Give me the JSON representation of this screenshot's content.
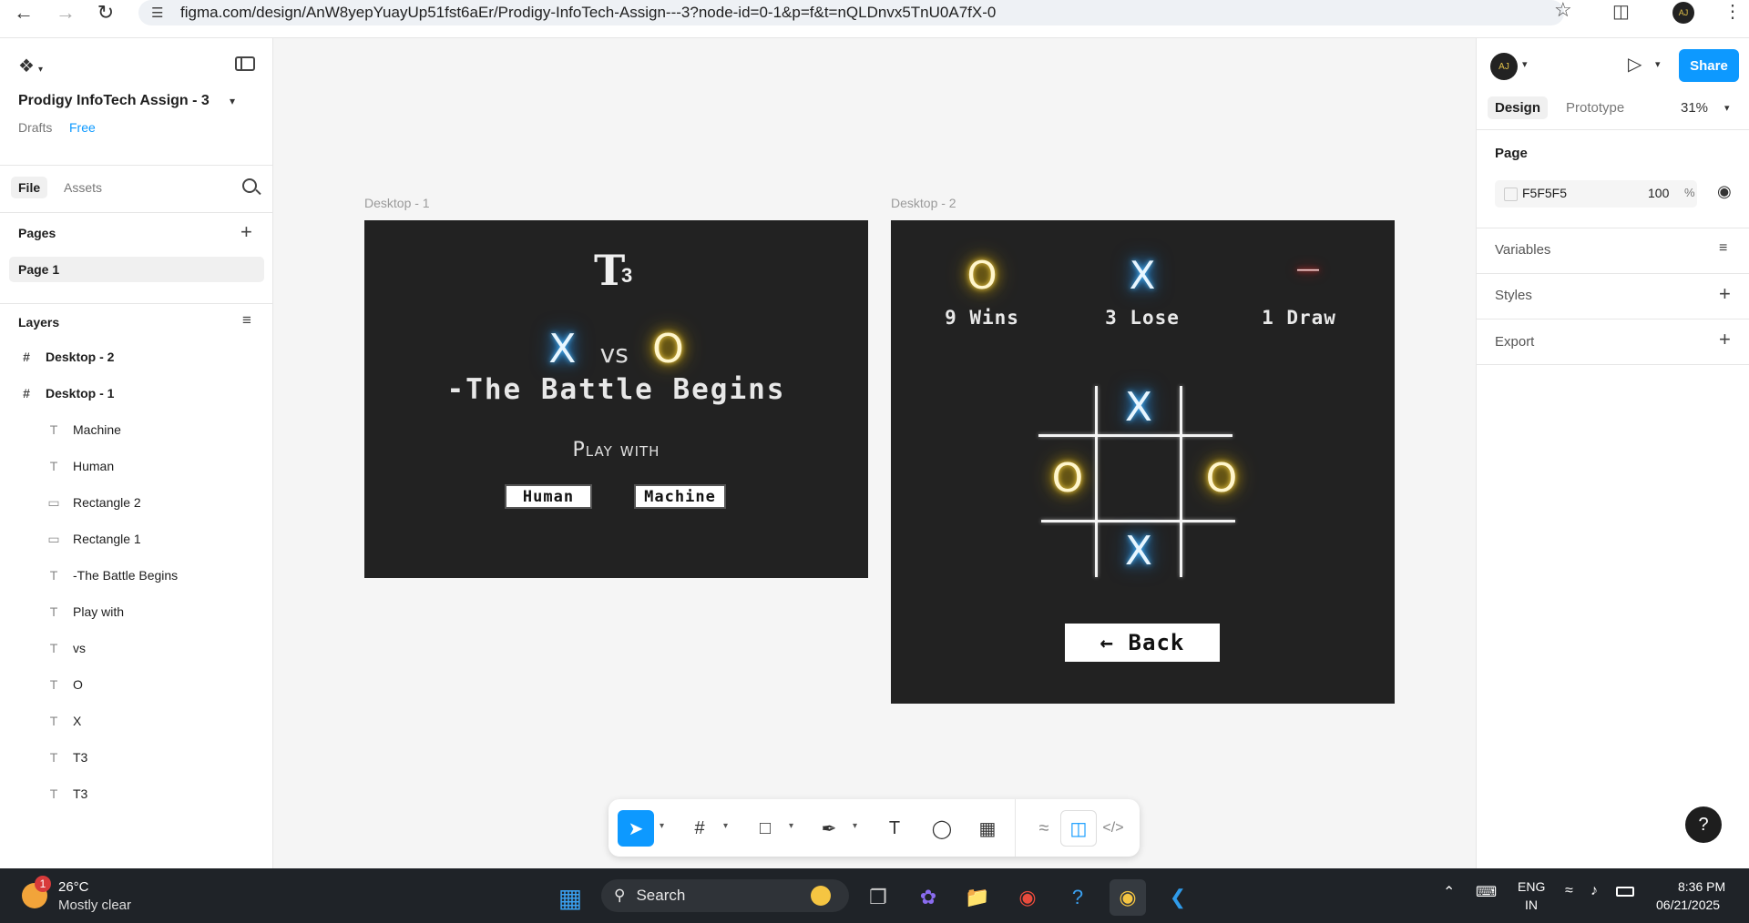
{
  "browser": {
    "url": "figma.com/design/AnW8yepYuayUp51fst6aEr/Prodigy-InfoTech-Assign---3?node-id=0-1&p=f&t=nQLDnvx5TnU0A7fX-0",
    "avatar_initials": "AJ"
  },
  "left_panel": {
    "file_title": "Prodigy InfoTech Assign - 3",
    "drafts_label": "Drafts",
    "plan_badge": "Free",
    "tabs": [
      {
        "label": "File"
      },
      {
        "label": "Assets"
      }
    ],
    "pages_title": "Pages",
    "pages": [
      {
        "label": "Page 1"
      }
    ],
    "layers_title": "Layers",
    "layers": [
      {
        "label": "Desktop - 2",
        "type": "frame"
      },
      {
        "label": "Desktop - 1",
        "type": "frame"
      },
      {
        "label": "Machine",
        "type": "text"
      },
      {
        "label": "Human",
        "type": "text"
      },
      {
        "label": "Rectangle 2",
        "type": "rect"
      },
      {
        "label": "Rectangle 1",
        "type": "rect"
      },
      {
        "label": "-The Battle Begins",
        "type": "text"
      },
      {
        "label": "Play with",
        "type": "text"
      },
      {
        "label": "vs",
        "type": "text"
      },
      {
        "label": "O",
        "type": "text"
      },
      {
        "label": "X",
        "type": "text"
      },
      {
        "label": "T3",
        "type": "text"
      },
      {
        "label": "T3",
        "type": "text"
      }
    ]
  },
  "canvas": {
    "frame1": {
      "label": "Desktop - 1",
      "logo_main": "T",
      "logo_sub": "3",
      "x_symbol": "X",
      "vs": "vs",
      "o_symbol": "O",
      "tagline": "-The Battle Begins",
      "play_with": "Play with",
      "human_button": "Human",
      "machine_button": "Machine"
    },
    "frame2": {
      "label": "Desktop - 2",
      "stats": [
        {
          "symbol": "O",
          "label": "9 Wins"
        },
        {
          "symbol": "X",
          "label": "3 Lose"
        },
        {
          "symbol": "—",
          "label": "1 Draw"
        }
      ],
      "board": [
        "",
        "X",
        "",
        "O",
        "",
        "O",
        "",
        "X",
        ""
      ],
      "back_button": "← Back"
    }
  },
  "right_panel": {
    "tabs": [
      {
        "label": "Design"
      },
      {
        "label": "Prototype"
      }
    ],
    "zoom": "31%",
    "share_label": "Share",
    "page_section": "Page",
    "page_fill_hex": "F5F5F5",
    "page_fill_opacity": "100",
    "percent_sign": "%",
    "variables_label": "Variables",
    "styles_label": "Styles",
    "export_label": "Export",
    "help_label": "?"
  },
  "taskbar": {
    "weather_temp": "26°C",
    "weather_desc": "Mostly clear",
    "weather_badge": "1",
    "search_placeholder": "Search",
    "lang_top": "ENG",
    "lang_bottom": "IN",
    "time": "8:36 PM",
    "date": "06/21/2025"
  },
  "colors": {
    "frame_bg": "#222222",
    "accent": "#0d99ff",
    "neon_blue": "#2a9dff",
    "neon_yellow": "#f2c200",
    "neon_red": "#e00000"
  }
}
